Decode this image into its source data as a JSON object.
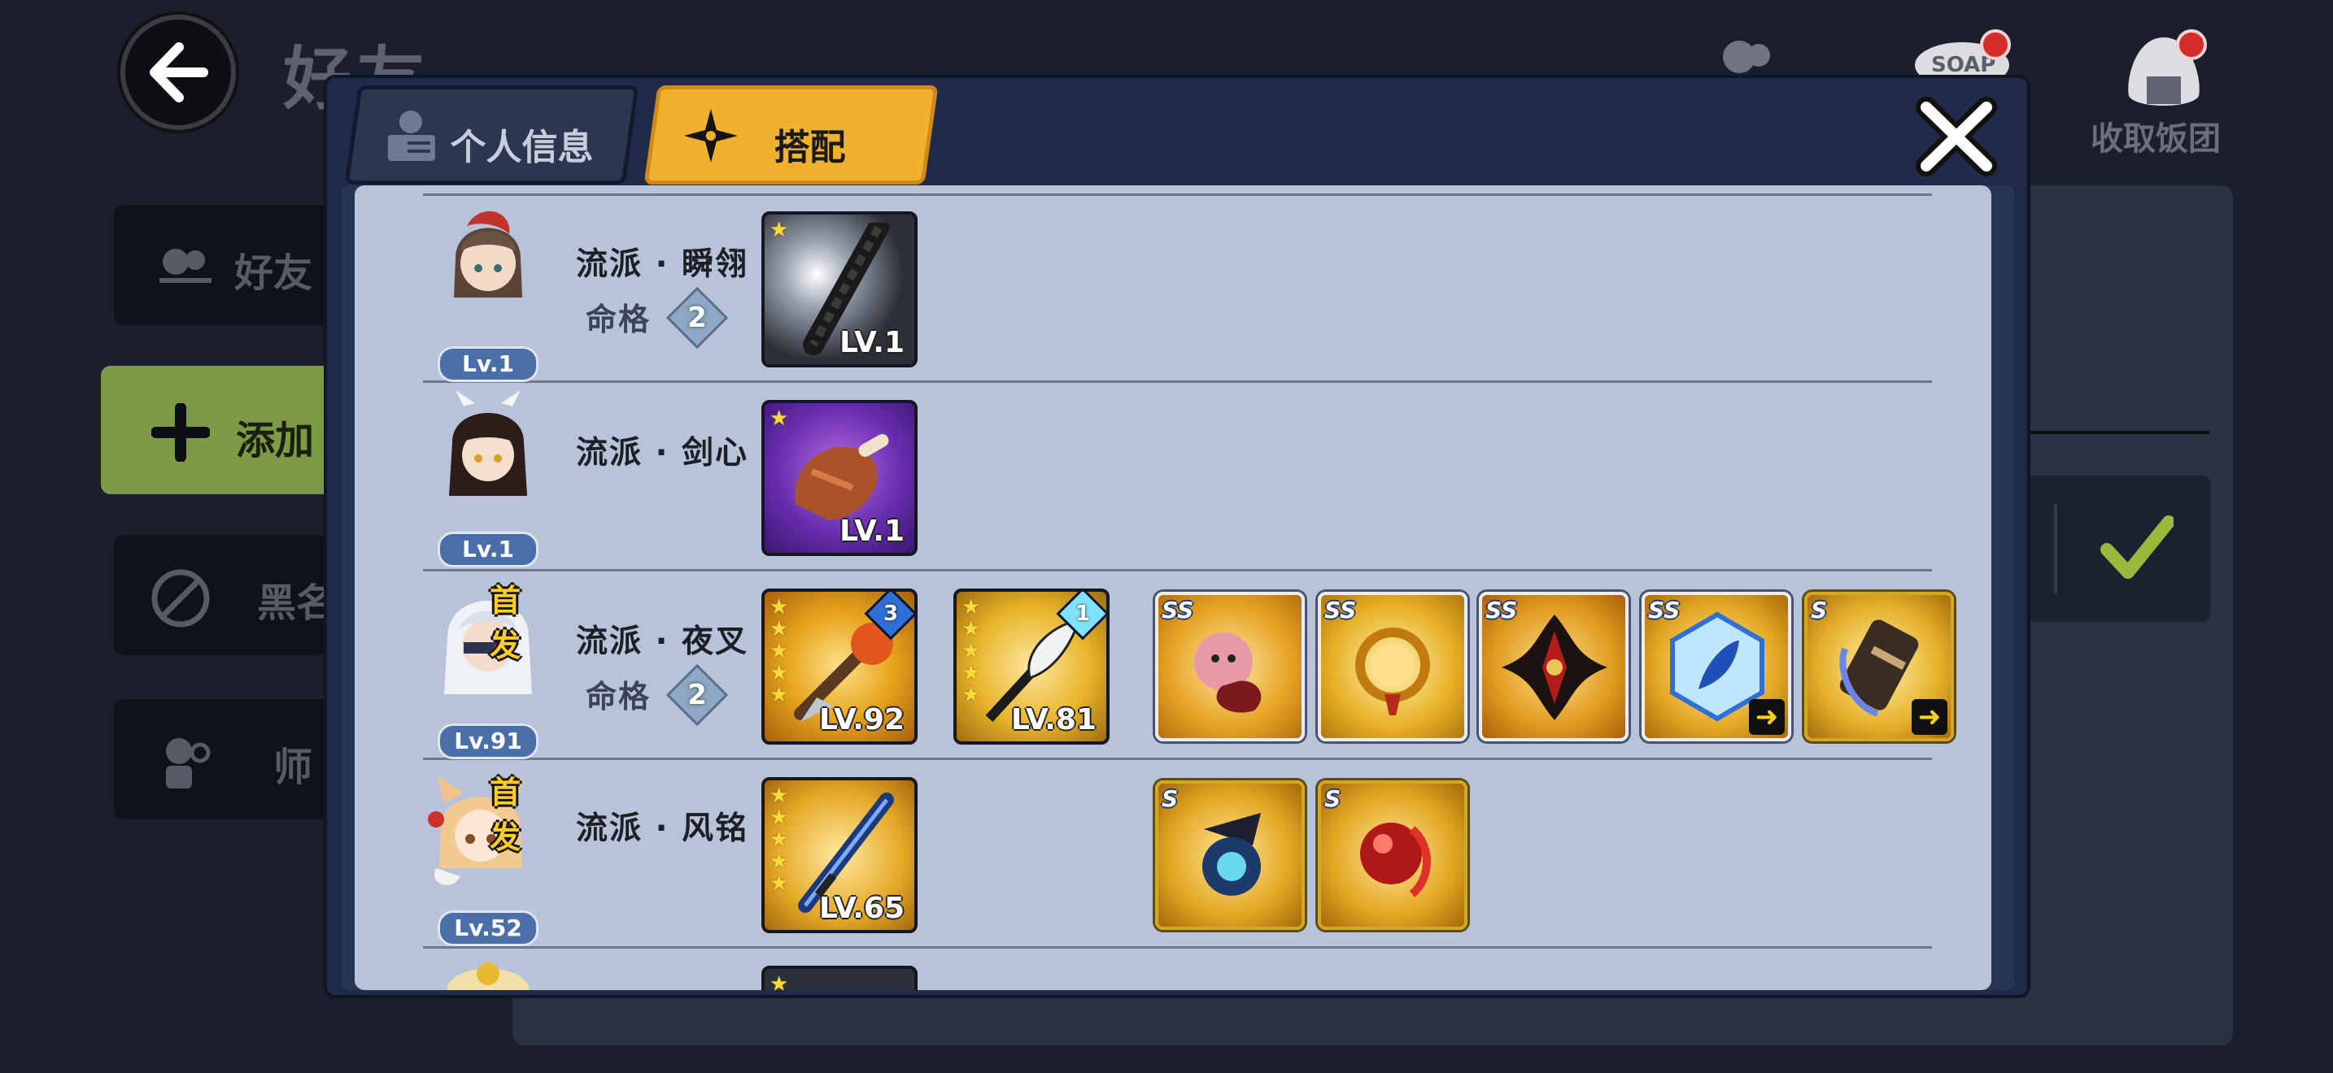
{
  "background": {
    "title": "好友",
    "collect_label": "收取饭团",
    "soap_text": "SOAP",
    "side_menu": [
      {
        "label": "好友"
      },
      {
        "label": "添加"
      },
      {
        "label": "黑名"
      },
      {
        "label": "师"
      }
    ]
  },
  "tabs": [
    {
      "label": "个人信息",
      "active": false
    },
    {
      "label": "搭配",
      "active": true
    }
  ],
  "close_label": "✕",
  "fate_label": "命格",
  "rows": [
    {
      "name": "流派 · 瞬翎",
      "level": "Lv.1",
      "fate": "2",
      "first": "",
      "weapons": [
        {
          "level": "LV.1",
          "stars": 1,
          "rank": ""
        }
      ],
      "items": []
    },
    {
      "name": "流派 · 剑心",
      "level": "Lv.1",
      "fate": "",
      "first": "",
      "weapons": [
        {
          "level": "LV.1",
          "stars": 1,
          "rank": ""
        }
      ],
      "items": []
    },
    {
      "name": "流派 · 夜叉",
      "level": "Lv.91",
      "fate": "2",
      "first": "首发",
      "weapons": [
        {
          "level": "LV.92",
          "stars": 5,
          "rank": "3"
        },
        {
          "level": "LV.81",
          "stars": 5,
          "rank": "1"
        }
      ],
      "items": [
        {
          "grade": "SS",
          "icon": "pink-beast-icon",
          "up": false
        },
        {
          "grade": "SS",
          "icon": "golden-orb-icon",
          "up": false
        },
        {
          "grade": "SS",
          "icon": "shuriken-icon",
          "up": false
        },
        {
          "grade": "SS",
          "icon": "blue-feather-crystal-icon",
          "up": true
        },
        {
          "grade": "S",
          "icon": "gauntlet-icon",
          "up": true
        }
      ]
    },
    {
      "name": "流派 · 风铭",
      "level": "Lv.52",
      "fate": "",
      "first": "首发",
      "weapons": [
        {
          "level": "LV.65",
          "stars": 5,
          "rank": ""
        }
      ],
      "items": [
        {
          "grade": "S",
          "icon": "blue-flame-lantern-icon",
          "up": false
        },
        {
          "grade": "S",
          "icon": "red-gem-icon",
          "up": false
        }
      ]
    }
  ],
  "colors": {
    "accent_tab": "#f0b22e",
    "panel": "#b8c3d9",
    "modal": "#1f2b48"
  }
}
